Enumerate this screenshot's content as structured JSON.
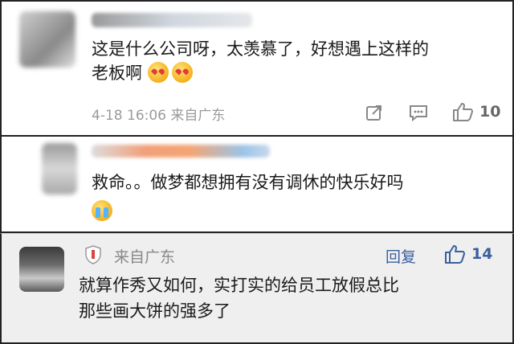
{
  "comments": [
    {
      "text_line1": "这是什么公司呀，太羡慕了，好想遇上这样的",
      "text_line2": "老板啊",
      "emojis": [
        "love-face-icon",
        "love-face-icon"
      ],
      "date": "4-18",
      "time": "16:06",
      "location": "来自广东",
      "likes": "10"
    },
    {
      "text_line1": "救命。。做梦都想拥有没有调休的快乐好吗",
      "emojis": [
        "crying-face-icon"
      ]
    },
    {
      "location": "来自广东",
      "reply_label": "回复",
      "likes": "14",
      "text_line1": "就算作秀又如何，实打实的给员工放假总比",
      "text_line2": "那些画大饼的强多了"
    }
  ]
}
